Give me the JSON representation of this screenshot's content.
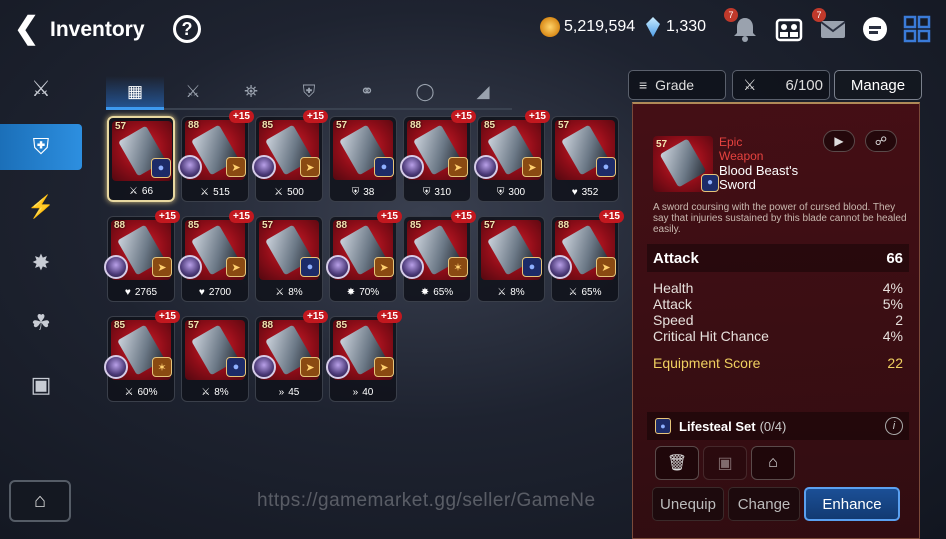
{
  "header": {
    "title": "Inventory",
    "help_label": "?",
    "gold": "5,219,594",
    "crystals": "1,330",
    "notif_badge": "7",
    "mail_badge": "7"
  },
  "tabs": [
    {
      "name": "all",
      "icon": "grid-icon"
    },
    {
      "name": "weapon",
      "icon": "sword-icon"
    },
    {
      "name": "helmet",
      "icon": "helmet-icon"
    },
    {
      "name": "armor",
      "icon": "armor-icon"
    },
    {
      "name": "necklace",
      "icon": "necklace-icon"
    },
    {
      "name": "ring",
      "icon": "ring-icon"
    },
    {
      "name": "boots",
      "icon": "boots-icon"
    }
  ],
  "toolbar": {
    "grade_label": "Grade",
    "count": "6/100",
    "manage_label": "Manage"
  },
  "items": [
    {
      "lvl": "57",
      "plus": "",
      "avatar": false,
      "set": "life",
      "stat_icon": "attack",
      "stat": "66",
      "selected": true
    },
    {
      "lvl": "88",
      "plus": "+15",
      "avatar": true,
      "set": "speed",
      "stat_icon": "attack",
      "stat": "515"
    },
    {
      "lvl": "85",
      "plus": "+15",
      "avatar": true,
      "set": "speed",
      "stat_icon": "attack",
      "stat": "500"
    },
    {
      "lvl": "57",
      "plus": "",
      "avatar": false,
      "set": "life",
      "stat_icon": "defense",
      "stat": "38"
    },
    {
      "lvl": "88",
      "plus": "+15",
      "avatar": true,
      "set": "speed",
      "stat_icon": "defense",
      "stat": "310"
    },
    {
      "lvl": "85",
      "plus": "+15",
      "avatar": true,
      "set": "speed",
      "stat_icon": "defense",
      "stat": "300"
    },
    {
      "lvl": "57",
      "plus": "",
      "avatar": false,
      "set": "life",
      "stat_icon": "health",
      "stat": "352"
    },
    {
      "lvl": "88",
      "plus": "+15",
      "avatar": true,
      "set": "speed",
      "stat_icon": "health",
      "stat": "2765"
    },
    {
      "lvl": "85",
      "plus": "+15",
      "avatar": true,
      "set": "speed",
      "stat_icon": "health",
      "stat": "2700"
    },
    {
      "lvl": "57",
      "plus": "",
      "avatar": false,
      "set": "life",
      "stat_icon": "attack",
      "stat": "8%"
    },
    {
      "lvl": "88",
      "plus": "+15",
      "avatar": true,
      "set": "speed",
      "stat_icon": "effect",
      "stat": "70%"
    },
    {
      "lvl": "85",
      "plus": "+15",
      "avatar": true,
      "set": "hit",
      "stat_icon": "effect",
      "stat": "65%"
    },
    {
      "lvl": "57",
      "plus": "",
      "avatar": false,
      "set": "life",
      "stat_icon": "attack",
      "stat": "8%"
    },
    {
      "lvl": "88",
      "plus": "+15",
      "avatar": true,
      "set": "speed",
      "stat_icon": "attack",
      "stat": "65%"
    },
    {
      "lvl": "85",
      "plus": "+15",
      "avatar": true,
      "set": "hit",
      "stat_icon": "attack",
      "stat": "60%"
    },
    {
      "lvl": "57",
      "plus": "",
      "avatar": false,
      "set": "life",
      "stat_icon": "attack",
      "stat": "8%"
    },
    {
      "lvl": "88",
      "plus": "+15",
      "avatar": true,
      "set": "speed",
      "stat_icon": "speed",
      "stat": "45"
    },
    {
      "lvl": "85",
      "plus": "+15",
      "avatar": true,
      "set": "speed",
      "stat_icon": "speed",
      "stat": "40"
    }
  ],
  "detail": {
    "level": "57",
    "grade_line1": "Epic",
    "grade_line2": "Weapon",
    "name": "Blood Beast's Sword",
    "description": "A sword coursing with the power of cursed blood. They say that injuries sustained by this blade cannot be healed easily.",
    "main_stat_label": "Attack",
    "main_stat_value": "66",
    "substats": [
      {
        "label": "Health",
        "value": "4%"
      },
      {
        "label": "Attack",
        "value": "5%"
      },
      {
        "label": "Speed",
        "value": "2"
      },
      {
        "label": "Critical Hit Chance",
        "value": "4%"
      }
    ],
    "score_label": "Equipment Score",
    "score_value": "22",
    "set_name": "Lifesteal Set",
    "set_progress": "(0/4)"
  },
  "buttons": {
    "unequip": "Unequip",
    "change": "Change",
    "enhance": "Enhance"
  },
  "watermark": "https://gamemarket.gg/seller/GameNe"
}
